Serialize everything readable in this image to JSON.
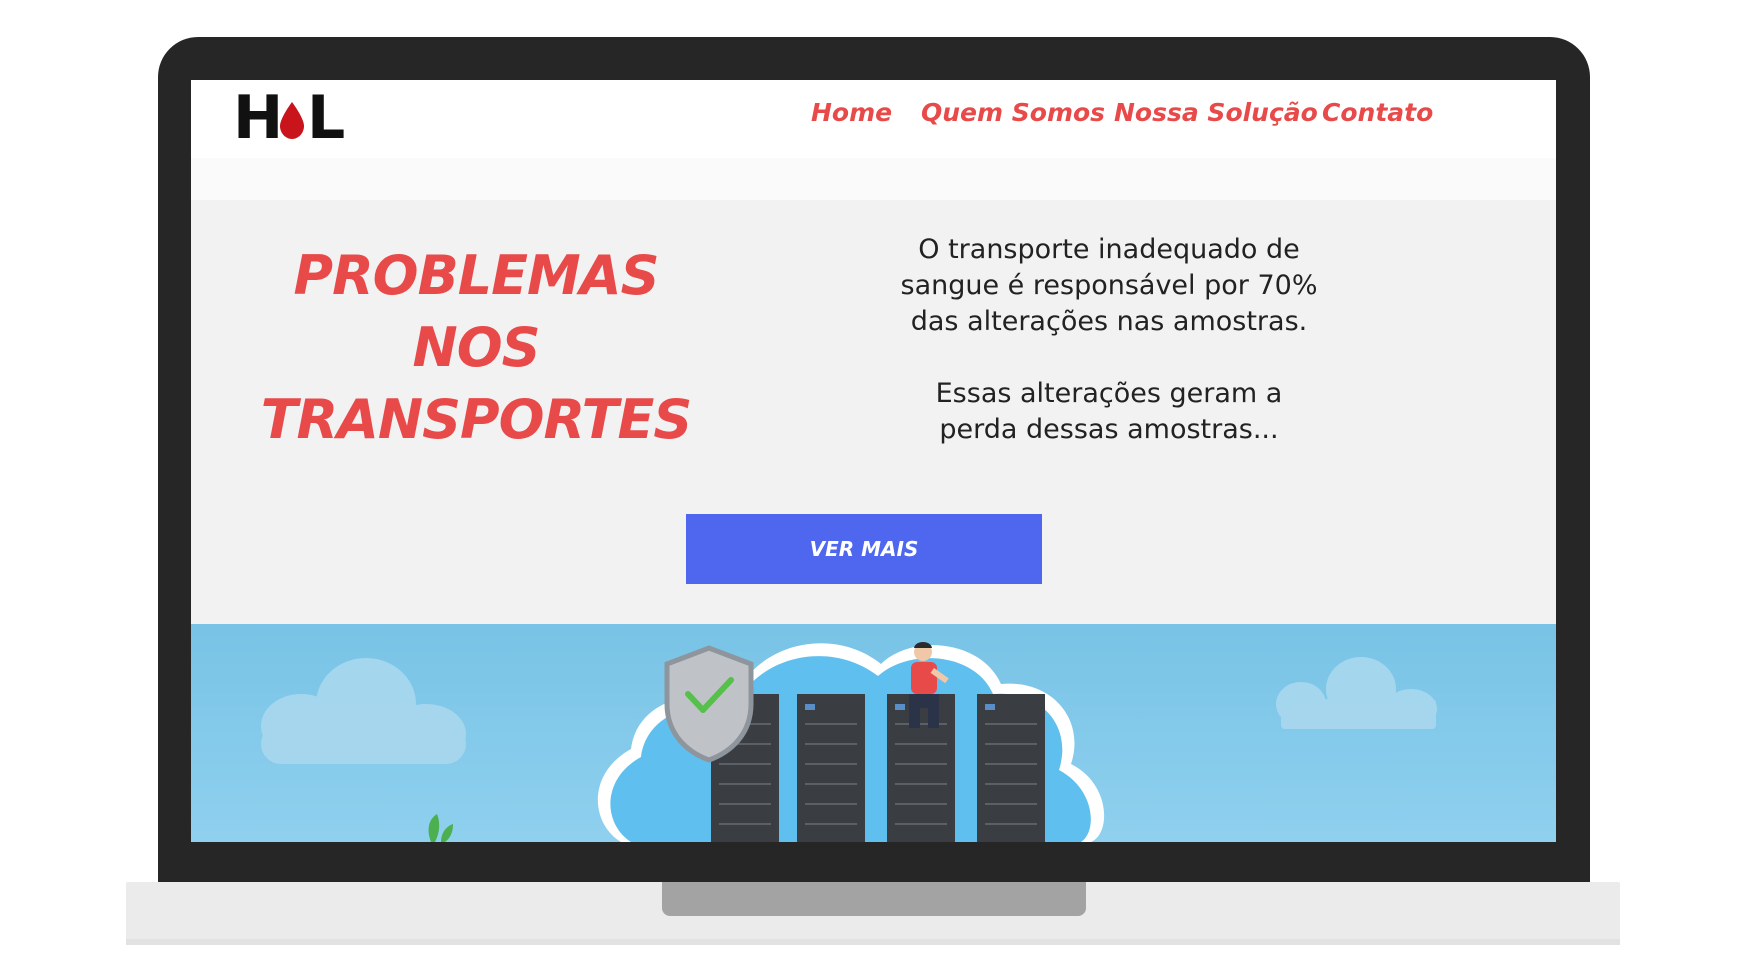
{
  "logo": {
    "letters": [
      "H",
      "L"
    ],
    "alt": "H L"
  },
  "nav": {
    "items": [
      {
        "label": "Home"
      },
      {
        "label": "Quem Somos"
      },
      {
        "label": "Nossa Solução"
      },
      {
        "label": "Contato"
      }
    ]
  },
  "hero": {
    "title_lines": [
      "PROBLEMAS",
      "NOS",
      "TRANSPORTES"
    ],
    "paragraph1_lines": [
      "O transporte inadequado de",
      "sangue é responsável por 70%",
      "das alterações nas amostras."
    ],
    "paragraph2_lines": [
      "Essas alterações geram a",
      "perda dessas amostras..."
    ],
    "cta_label": "VER MAIS"
  },
  "colors": {
    "accent_red": "#e84a4a",
    "button_blue": "#4e67ee",
    "hero_bg": "#f2f2f2",
    "sky_blue": "#7fc8ea"
  },
  "illustration": {
    "icons": [
      "cloud-icon",
      "shield-check-icon",
      "server-rack-icon",
      "person-icon"
    ]
  }
}
